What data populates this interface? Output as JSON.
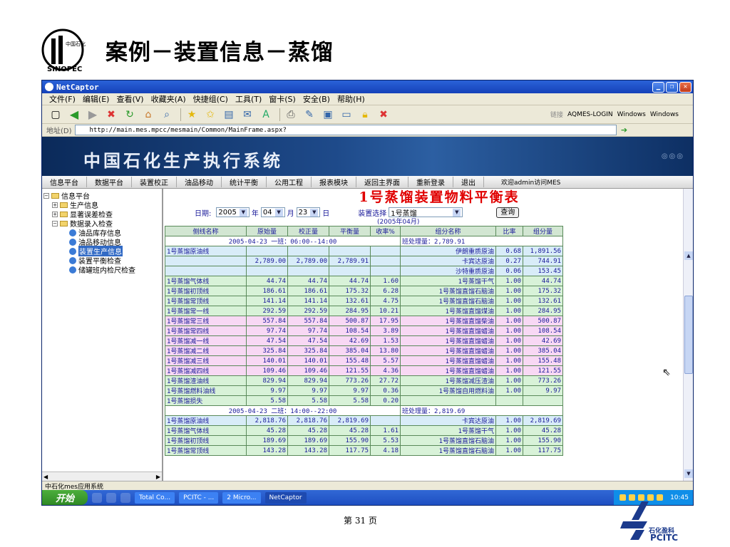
{
  "slide": {
    "title": "案例－装置信息－蒸馏",
    "page_number": "第 31 页",
    "logo_caption": "Sinopec",
    "brand_cn": "石化盈科",
    "brand_en": "PCITC"
  },
  "window": {
    "title": "NetCaptor",
    "menu": [
      "文件(F)",
      "编辑(E)",
      "查看(V)",
      "收藏夹(A)",
      "快捷组(C)",
      "工具(T)",
      "窗卡(S)",
      "安全(B)",
      "帮助(H)"
    ],
    "links_label": "链接",
    "links": [
      "AQMES-LOGIN",
      "Windows",
      "Windows"
    ],
    "address_label": "地址(D)",
    "address_url": "http://main.mes.mpcc/mesmain/Common/MainFrame.aspx?"
  },
  "app": {
    "banner_title": "中国石化生产执行系统",
    "nav": [
      "信息平台",
      "数据平台",
      "装置校正",
      "油品移动",
      "统计平衡",
      "公用工程",
      "报表模块",
      "返回主界面",
      "重新登录",
      "退出"
    ],
    "welcome": "欢迎admin访问MES"
  },
  "tree": {
    "root": "信息平台",
    "nodes": [
      "生产信息",
      "显著误差检查",
      "数据录入检查"
    ],
    "leaves": [
      "油品库存信息",
      "油品移动信息",
      "装置生产信息",
      "装置平衡检查",
      "储罐班内检尺检查"
    ],
    "selected_leaf": "装置生产信息"
  },
  "report": {
    "title": "1号蒸馏装置物料平衡表",
    "date_label": "日期:",
    "year": "2005",
    "year_unit": "年",
    "month": "04",
    "month_unit": "月",
    "day": "23",
    "day_unit": "日",
    "device_label": "装置选择",
    "device": "1号蒸馏",
    "query_button": "查询",
    "period": "(2005年04月)",
    "columns": [
      "侧线名称",
      "原始量",
      "校正量",
      "平衡量",
      "收率%",
      "组分名称",
      "比率",
      "组分量"
    ]
  },
  "rows": [
    {
      "type": "shift",
      "text": "2005-04-23 一班：06:00--14:00",
      "proc": "班处理量：2,789.91"
    },
    {
      "type": "data",
      "c": "b",
      "name": "1号蒸馏原油线",
      "raw": "",
      "corr": "",
      "bal": "",
      "yield": "",
      "comp": "伊朗重质原油",
      "ratio": "0.68",
      "amt": "1,891.56"
    },
    {
      "type": "data",
      "c": "b",
      "name": "",
      "raw": "2,789.00",
      "corr": "2,789.00",
      "bal": "2,789.91",
      "yield": "",
      "comp": "卡宾达原油",
      "ratio": "0.27",
      "amt": "744.91"
    },
    {
      "type": "data",
      "c": "b",
      "name": "",
      "raw": "",
      "corr": "",
      "bal": "",
      "yield": "",
      "comp": "沙特重质原油",
      "ratio": "0.06",
      "amt": "153.45"
    },
    {
      "type": "data",
      "c": "g",
      "name": "1号蒸馏气体线",
      "raw": "44.74",
      "corr": "44.74",
      "bal": "44.74",
      "yield": "1.60",
      "comp": "1号蒸馏干气",
      "ratio": "1.00",
      "amt": "44.74"
    },
    {
      "type": "data",
      "c": "g",
      "name": "1号蒸馏初顶线",
      "raw": "186.61",
      "corr": "186.61",
      "bal": "175.32",
      "yield": "6.28",
      "comp": "1号蒸馏直馏石脑油",
      "ratio": "1.00",
      "amt": "175.32"
    },
    {
      "type": "data",
      "c": "g",
      "name": "1号蒸馏常顶线",
      "raw": "141.14",
      "corr": "141.14",
      "bal": "132.61",
      "yield": "4.75",
      "comp": "1号蒸馏直馏石脑油",
      "ratio": "1.00",
      "amt": "132.61"
    },
    {
      "type": "data",
      "c": "g",
      "name": "1号蒸馏常一线",
      "raw": "292.59",
      "corr": "292.59",
      "bal": "284.95",
      "yield": "10.21",
      "comp": "1号蒸馏直馏煤油",
      "ratio": "1.00",
      "amt": "284.95"
    },
    {
      "type": "data",
      "c": "p",
      "name": "1号蒸馏常三线",
      "raw": "557.84",
      "corr": "557.84",
      "bal": "500.87",
      "yield": "17.95",
      "comp": "1号蒸馏直馏柴油",
      "ratio": "1.00",
      "amt": "500.87"
    },
    {
      "type": "data",
      "c": "p",
      "name": "1号蒸馏常四线",
      "raw": "97.74",
      "corr": "97.74",
      "bal": "108.54",
      "yield": "3.89",
      "comp": "1号蒸馏直馏蜡油",
      "ratio": "1.00",
      "amt": "108.54"
    },
    {
      "type": "data",
      "c": "p",
      "name": "1号蒸馏减一线",
      "raw": "47.54",
      "corr": "47.54",
      "bal": "42.69",
      "yield": "1.53",
      "comp": "1号蒸馏直馏蜡油",
      "ratio": "1.00",
      "amt": "42.69"
    },
    {
      "type": "data",
      "c": "p",
      "name": "1号蒸馏减二线",
      "raw": "325.84",
      "corr": "325.84",
      "bal": "385.04",
      "yield": "13.80",
      "comp": "1号蒸馏直馏蜡油",
      "ratio": "1.00",
      "amt": "385.04"
    },
    {
      "type": "data",
      "c": "p",
      "name": "1号蒸馏减三线",
      "raw": "140.01",
      "corr": "140.01",
      "bal": "155.48",
      "yield": "5.57",
      "comp": "1号蒸馏直馏蜡油",
      "ratio": "1.00",
      "amt": "155.48"
    },
    {
      "type": "data",
      "c": "p",
      "name": "1号蒸馏减四线",
      "raw": "109.46",
      "corr": "109.46",
      "bal": "121.55",
      "yield": "4.36",
      "comp": "1号蒸馏直馏蜡油",
      "ratio": "1.00",
      "amt": "121.55"
    },
    {
      "type": "data",
      "c": "g",
      "name": "1号蒸馏渣油线",
      "raw": "829.94",
      "corr": "829.94",
      "bal": "773.26",
      "yield": "27.72",
      "comp": "1号蒸馏减压渣油",
      "ratio": "1.00",
      "amt": "773.26"
    },
    {
      "type": "data",
      "c": "g",
      "name": "1号蒸馏燃料油线",
      "raw": "9.97",
      "corr": "9.97",
      "bal": "9.97",
      "yield": "0.36",
      "comp": "1号蒸馏自用燃料油",
      "ratio": "1.00",
      "amt": "9.97"
    },
    {
      "type": "data",
      "c": "g",
      "name": "1号蒸馏损失",
      "raw": "5.58",
      "corr": "5.58",
      "bal": "5.58",
      "yield": "0.20",
      "comp": "",
      "ratio": "",
      "amt": ""
    },
    {
      "type": "shift",
      "text": "2005-04-23 二班：14:00--22:00",
      "proc": "班处理量：2,819.69"
    },
    {
      "type": "data",
      "c": "b",
      "name": "1号蒸馏原油线",
      "raw": "2,818.76",
      "corr": "2,818.76",
      "bal": "2,819.69",
      "yield": "",
      "comp": "卡宾达原油",
      "ratio": "1.00",
      "amt": "2,819.69"
    },
    {
      "type": "data",
      "c": "g",
      "name": "1号蒸馏气体线",
      "raw": "45.28",
      "corr": "45.28",
      "bal": "45.28",
      "yield": "1.61",
      "comp": "1号蒸馏干气",
      "ratio": "1.00",
      "amt": "45.28"
    },
    {
      "type": "data",
      "c": "g",
      "name": "1号蒸馏初顶线",
      "raw": "189.69",
      "corr": "189.69",
      "bal": "155.90",
      "yield": "5.53",
      "comp": "1号蒸馏直馏石脑油",
      "ratio": "1.00",
      "amt": "155.90"
    },
    {
      "type": "data",
      "c": "g",
      "name": "1号蒸馏常顶线",
      "raw": "143.28",
      "corr": "143.28",
      "bal": "117.75",
      "yield": "4.18",
      "comp": "1号蒸馏直馏石脑油",
      "ratio": "1.00",
      "amt": "117.75"
    }
  ],
  "status": {
    "left_text": "中石化mes应用系统"
  },
  "taskbar": {
    "start": "开始",
    "tasks": [
      "Total Co...",
      "PCITC - ...",
      "2 Micro...",
      "NetCaptor"
    ],
    "clock": "10:45"
  },
  "colors": {
    "title_red": "#e00000",
    "row_green": "#d8f2d8",
    "row_pink": "#f8d8f4",
    "row_blue": "#d8ecf8",
    "brand_blue": "#1b3a8c"
  }
}
